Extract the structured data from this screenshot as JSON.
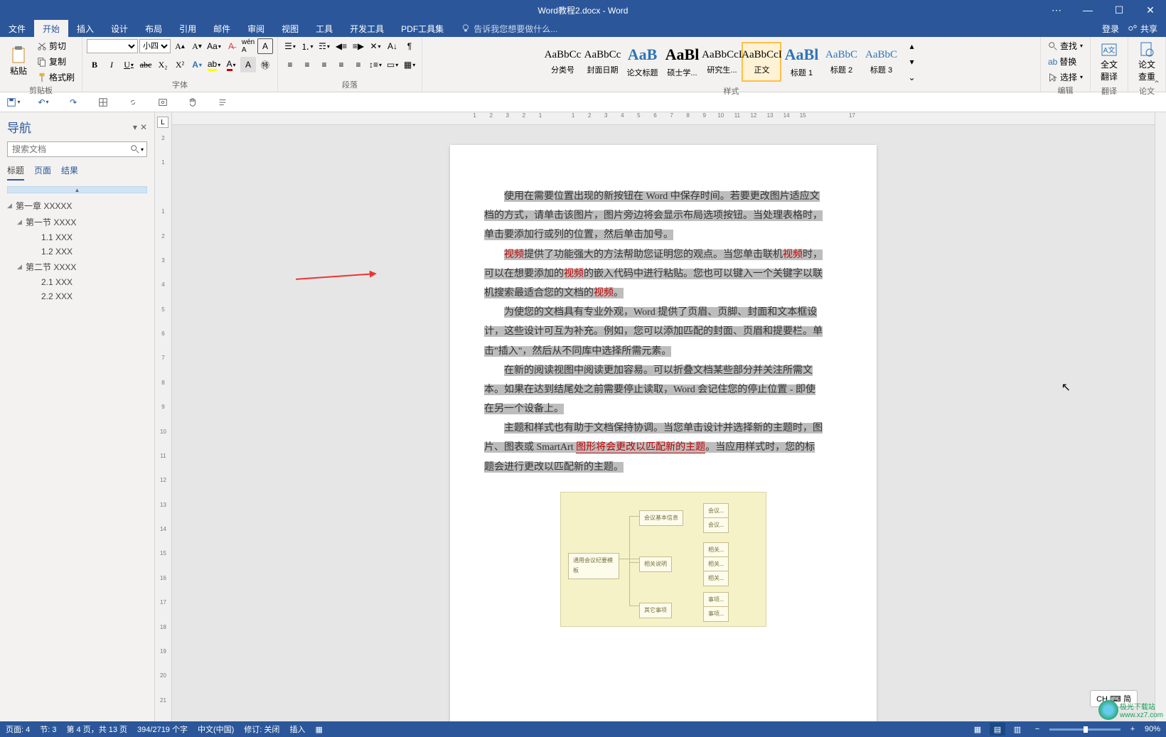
{
  "title_bar": {
    "doc_name": "Word教程2.docx - Word"
  },
  "window_controls": {
    "opts": "⋯",
    "min": "—",
    "max": "☐",
    "close": "✕"
  },
  "ribbon_tabs": {
    "file": "文件",
    "home": "开始",
    "insert": "插入",
    "design": "设计",
    "layout": "布局",
    "references": "引用",
    "mailings": "邮件",
    "review": "审阅",
    "view": "视图",
    "tools": "工具",
    "developer": "开发工具",
    "pdf": "PDF工具集",
    "tell_me": "告诉我您想要做什么...",
    "signin": "登录",
    "share": "共享"
  },
  "clipboard": {
    "group": "剪贴板",
    "paste": "粘贴",
    "cut": "剪切",
    "copy": "复制",
    "format_painter": "格式刷"
  },
  "font": {
    "group": "字体",
    "name": "",
    "size": "小四",
    "bold": "B",
    "italic": "I",
    "underline": "U",
    "strike": "abc",
    "subscript": "X₂",
    "superscript": "X²"
  },
  "paragraph": {
    "group": "段落"
  },
  "styles": {
    "group": "样式",
    "list": [
      {
        "name": "分类号",
        "preview": "AaBbCc"
      },
      {
        "name": "封面日期",
        "preview": "AaBbCc"
      },
      {
        "name": "论文标题",
        "preview": "AaB"
      },
      {
        "name": "硕士学...",
        "preview": "AaBl"
      },
      {
        "name": "研究生...",
        "preview": "AaBbCcI"
      },
      {
        "name": "正文",
        "preview": "AaBbCcI",
        "selected": true
      },
      {
        "name": "标题 1",
        "preview": "AaBl"
      },
      {
        "name": "标题 2",
        "preview": "AaBbC"
      },
      {
        "name": "标题 3",
        "preview": "AaBbC"
      }
    ]
  },
  "editing": {
    "group": "编辑",
    "find": "查找",
    "replace": "替换",
    "select": "选择"
  },
  "translate": {
    "group": "翻译",
    "full": "全文",
    "btn": "翻译"
  },
  "dup_check": {
    "group": "论文",
    "line1": "论文",
    "line2": "查重"
  },
  "navigation": {
    "title": "导航",
    "search_placeholder": "搜索文档",
    "tabs": {
      "headings": "标题",
      "pages": "页面",
      "results": "结果"
    },
    "tree": [
      {
        "level": 0,
        "text": "第一章 XXXXX",
        "caret": "◢"
      },
      {
        "level": 1,
        "text": "第一节 XXXX",
        "caret": "◢"
      },
      {
        "level": 2,
        "text": "1.1 XXX"
      },
      {
        "level": 2,
        "text": "1.2 XXX"
      },
      {
        "level": 1,
        "text": "第二节 XXXX",
        "caret": "◢"
      },
      {
        "level": 2,
        "text": "2.1 XXX"
      },
      {
        "level": 2,
        "text": "2.2 XXX"
      }
    ]
  },
  "ruler": {
    "corner": "L",
    "h": [
      "",
      "1",
      "2",
      "3",
      "2",
      "1",
      "",
      "1",
      "2",
      "3",
      "4",
      "5",
      "6",
      "7",
      "8",
      "9",
      "10",
      "11",
      "12",
      "13",
      "14",
      "15",
      "",
      "",
      "17",
      ""
    ],
    "v": [
      "2",
      "1",
      "",
      "1",
      "2",
      "3",
      "4",
      "5",
      "6",
      "7",
      "8",
      "9",
      "10",
      "11",
      "12",
      "13",
      "14",
      "15",
      "16",
      "17",
      "18",
      "19",
      "20",
      "21"
    ]
  },
  "document": {
    "p1_a": "使用在需要位置出现的新按钮在 Word 中保存时间。若要更改图片适应文",
    "p1_b": "档的方式，请单击该图片，图片旁边将会显示布局选项按钮。当处理表格时，",
    "p1_c": "单击要添加行或列的位置，然后单击加号。",
    "p2_a1": "视频",
    "p2_a2": "提供了功能强大的方法帮助您证明您的观点。当您单击联机",
    "p2_a3": "视频",
    "p2_a4": "时，",
    "p2_b1": "可以在想要添加的",
    "p2_b2": "视频",
    "p2_b3": "的嵌入代码中进行粘贴。您也可以键入一个关键字以联",
    "p2_c1": "机搜索最适合您的文档的",
    "p2_c2": "视频",
    "p2_c3": "。",
    "p3_a": "为使您的文档具有专业外观，Word 提供了页眉、页脚、封面和文本框设",
    "p3_b": "计，这些设计可互为补充。例如，您可以添加匹配的封面、页眉和提要栏。单",
    "p3_c": "击\"插入\"，然后从不同库中选择所需元素。",
    "p4_a": "在新的阅读视图中阅读更加容易。可以折叠文档某些部分并关注所需文",
    "p4_b": "本。如果在达到结尾处之前需要停止读取，Word 会记住您的停止位置 - 即使",
    "p4_c": "在另一个设备上。",
    "p5_a": "主题和样式也有助于文档保持协调。当您单击设计并选择新的主题时，图",
    "p5_b1": "片、图表或 SmartArt ",
    "p5_b2": "图形将会更改以匹配新的主题",
    "p5_b3": "。当应用样式时，您的标",
    "p5_c": "题会进行更改以匹配新的主题。"
  },
  "mindmap": {
    "root": "通用会议纪要模板",
    "n1": "会议基本信息",
    "n2": "相关说明",
    "n3": "其它事项",
    "leafA": "会议...",
    "leafB": "相关...",
    "leafC": "事项..."
  },
  "ime": {
    "text": "CH ⌨ 简"
  },
  "status": {
    "page_info": "页面: 4",
    "section": "节: 3",
    "page_of": "第 4 页，共 13 页",
    "words": "394/2719 个字",
    "lang": "中文(中国)",
    "track": "修订: 关闭",
    "insert": "插入",
    "zoom": "90%"
  },
  "watermark": {
    "line1": "极光下载站",
    "line2": "www.xz7.com"
  }
}
